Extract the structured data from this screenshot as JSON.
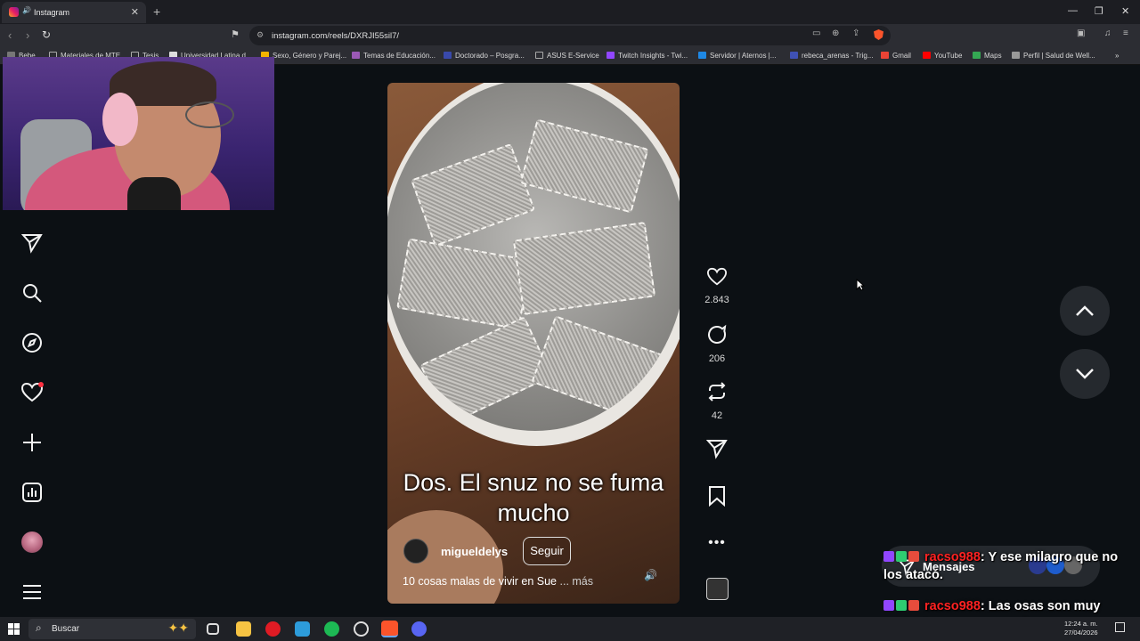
{
  "browser": {
    "tab_title": "Instagram",
    "tab_close": "✕",
    "new_tab": "+",
    "url": "instagram.com/reels/DXRJI55sil7/",
    "window_controls": {
      "minimize": "—",
      "restore": "❐",
      "close": "✕"
    }
  },
  "bookmarks": [
    {
      "label": "Bebe",
      "color": "#777777"
    },
    {
      "label": "Materiales de MTE",
      "color": "#888888"
    },
    {
      "label": "Tesis",
      "color": "#888888"
    },
    {
      "label": "Universidad Latina d...",
      "color": "#dddddd"
    },
    {
      "label": "Sexo, Género y Parej...",
      "color": "#f4b400"
    },
    {
      "label": "Temas de Educación...",
      "color": "#9b59b6"
    },
    {
      "label": "Doctorado – Posgra...",
      "color": "#3949ab"
    },
    {
      "label": "ASUS E-Service",
      "color": "#888888"
    },
    {
      "label": "Twitch Insights - Twi...",
      "color": "#9146ff"
    },
    {
      "label": "Servidor | Aternos |...",
      "color": "#1e88e5"
    },
    {
      "label": "rebeca_arenas - Trig...",
      "color": "#3f51b5"
    },
    {
      "label": "Gmail",
      "color": "#ea4335"
    },
    {
      "label": "YouTube",
      "color": "#ff0000"
    },
    {
      "label": "Maps",
      "color": "#34a853"
    },
    {
      "label": "Perfil | Salud de Well...",
      "color": "#999999"
    }
  ],
  "sidebar": [
    "messages-icon",
    "search-icon",
    "explore-icon",
    "notifications-icon",
    "create-icon",
    "dashboard-icon",
    "profile-avatar",
    "menu-icon"
  ],
  "reel": {
    "caption": "Dos. El snuz no se fuma mucho",
    "author": "migueldelys",
    "follow_label": "Seguir",
    "description": "10 cosas malas de vivir en Sue",
    "more_label": "... más"
  },
  "actions": {
    "likes": "2.843",
    "comments": "206",
    "reposts": "42"
  },
  "messages_label": "Mensajes",
  "chat": [
    {
      "user": "racso988",
      "text": ": Y ese milagro que no los atacó."
    },
    {
      "user": "racso988",
      "text": ": Las osas son muy protectoras con sus crías."
    }
  ],
  "taskbar": {
    "search_placeholder": "Buscar",
    "time": "12:24 a. m.",
    "date": "27/04/2026"
  }
}
